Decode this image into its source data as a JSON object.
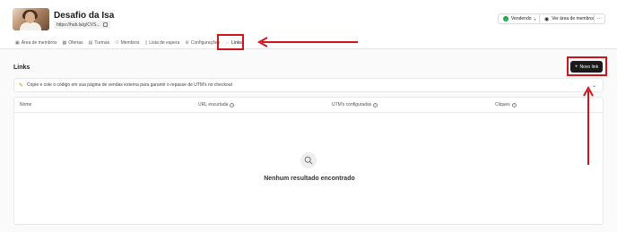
{
  "product": {
    "title": "Desafio da Isa",
    "url": "https://hub.la/g/CVS..."
  },
  "header_actions": {
    "status_label": "Vendendo",
    "members_label": "Ver área de membros",
    "more_label": "···"
  },
  "tabs": [
    {
      "label": "Área de membros",
      "icon": "members-area-icon"
    },
    {
      "label": "Ofertas",
      "icon": "offers-icon"
    },
    {
      "label": "Turmas",
      "icon": "classes-icon"
    },
    {
      "label": "Membros",
      "icon": "users-icon"
    },
    {
      "label": "Lista de espera",
      "icon": "waitlist-icon"
    },
    {
      "label": "Configurações",
      "icon": "gear-icon"
    },
    {
      "label": "Links",
      "icon": "link-icon",
      "active": true
    }
  ],
  "main": {
    "title": "Links",
    "new_button": "Novo link",
    "tip": "Copie e cole o código em sua página de vendas externa para garantir o repasse de UTM's no checkout",
    "table_headers": [
      "Nome",
      "URL encurtada",
      "UTM's configuradas",
      "Cliques"
    ],
    "empty_message": "Nenhum resultado encontrado"
  },
  "colors": {
    "accent_dark": "#1a1a1a",
    "status_green": "#1fa34a",
    "annotation_red": "#d0141b"
  }
}
